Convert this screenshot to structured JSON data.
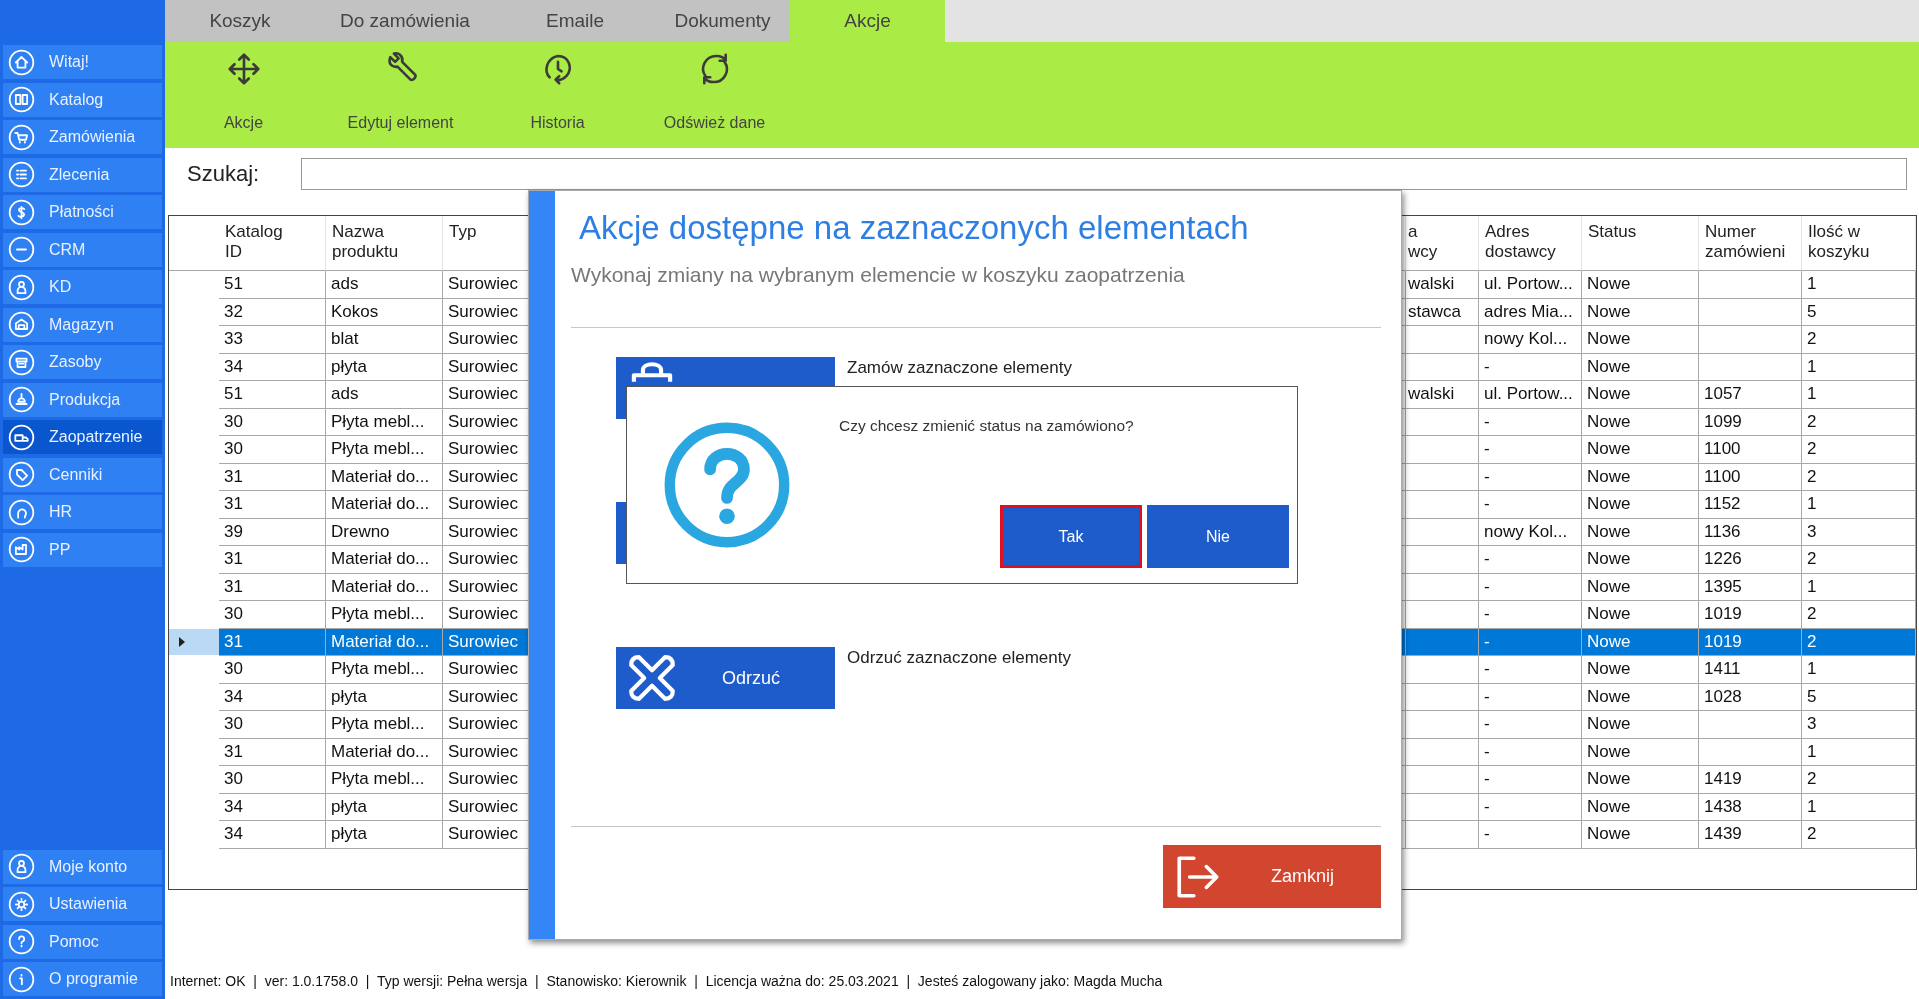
{
  "sidebar": {
    "items": [
      {
        "label": "Witaj!",
        "selected": false
      },
      {
        "label": "Katalog",
        "selected": false
      },
      {
        "label": "Zamówienia",
        "selected": false
      },
      {
        "label": "Zlecenia",
        "selected": false
      },
      {
        "label": "Płatności",
        "selected": false
      },
      {
        "label": "CRM",
        "selected": false
      },
      {
        "label": "KD",
        "selected": false
      },
      {
        "label": "Magazyn",
        "selected": false
      },
      {
        "label": "Zasoby",
        "selected": false
      },
      {
        "label": "Produkcja",
        "selected": false
      },
      {
        "label": "Zaopatrzenie",
        "selected": true
      },
      {
        "label": "Cenniki",
        "selected": false
      },
      {
        "label": "HR",
        "selected": false
      },
      {
        "label": "PP",
        "selected": false
      }
    ],
    "bottom_items": [
      {
        "label": "Moje konto"
      },
      {
        "label": "Ustawienia"
      },
      {
        "label": "Pomoc"
      },
      {
        "label": "O programie"
      }
    ]
  },
  "tabs": [
    {
      "label": "Koszyk",
      "selected": false
    },
    {
      "label": "Do zamówienia",
      "selected": false
    },
    {
      "label": "Emaile",
      "selected": false
    },
    {
      "label": "Dokumenty",
      "selected": false
    },
    {
      "label": "Akcje",
      "selected": true
    }
  ],
  "toolbar": [
    {
      "label": "Akcje"
    },
    {
      "label": "Edytuj element"
    },
    {
      "label": "Historia"
    },
    {
      "label": "Odśwież dane"
    }
  ],
  "search": {
    "label": "Szukaj:"
  },
  "table": {
    "columns": [
      "Katalog\nID",
      "Nazwa\nproduktu",
      "Typ",
      null,
      "a\nwcy",
      "Adres\ndostawcy",
      "Status",
      "Numer\nzamówieni",
      "Ilość w\nkoszyku"
    ],
    "rows": [
      {
        "selected": false,
        "cells": [
          "51",
          "ads",
          "Surowiec",
          null,
          "walski",
          "ul. Portow...",
          "Nowe",
          null,
          "1"
        ]
      },
      {
        "selected": false,
        "cells": [
          "32",
          "Kokos",
          "Surowiec",
          null,
          "stawca",
          "adres Mia...",
          "Nowe",
          null,
          "5"
        ]
      },
      {
        "selected": false,
        "cells": [
          "33",
          "blat",
          "Surowiec",
          null,
          null,
          "nowy Kol...",
          "Nowe",
          null,
          "2"
        ]
      },
      {
        "selected": false,
        "cells": [
          "34",
          "płyta",
          "Surowiec",
          null,
          null,
          "-",
          "Nowe",
          null,
          "1"
        ]
      },
      {
        "selected": false,
        "cells": [
          "51",
          "ads",
          "Surowiec",
          null,
          "walski",
          "ul. Portow...",
          "Nowe",
          "1057",
          "1"
        ]
      },
      {
        "selected": false,
        "cells": [
          "30",
          "Płyta mebl...",
          "Surowiec",
          null,
          null,
          "-",
          "Nowe",
          "1099",
          "2"
        ]
      },
      {
        "selected": false,
        "cells": [
          "30",
          "Płyta mebl...",
          "Surowiec",
          null,
          null,
          "-",
          "Nowe",
          "1100",
          "2"
        ]
      },
      {
        "selected": false,
        "cells": [
          "31",
          "Materiał do...",
          "Surowiec",
          null,
          null,
          "-",
          "Nowe",
          "1100",
          "2"
        ]
      },
      {
        "selected": false,
        "cells": [
          "31",
          "Materiał do...",
          "Surowiec",
          null,
          null,
          "-",
          "Nowe",
          "1152",
          "1"
        ]
      },
      {
        "selected": false,
        "cells": [
          "39",
          "Drewno",
          "Surowiec",
          null,
          null,
          "nowy Kol...",
          "Nowe",
          "1136",
          "3"
        ]
      },
      {
        "selected": false,
        "cells": [
          "31",
          "Materiał do...",
          "Surowiec",
          null,
          null,
          "-",
          "Nowe",
          "1226",
          "2"
        ]
      },
      {
        "selected": false,
        "cells": [
          "31",
          "Materiał do...",
          "Surowiec",
          null,
          null,
          "-",
          "Nowe",
          "1395",
          "1"
        ]
      },
      {
        "selected": false,
        "cells": [
          "30",
          "Płyta mebl...",
          "Surowiec",
          null,
          null,
          "-",
          "Nowe",
          "1019",
          "2"
        ]
      },
      {
        "selected": true,
        "cells": [
          "31",
          "Materiał do...",
          "Surowiec",
          null,
          null,
          "-",
          "Nowe",
          "1019",
          "2"
        ]
      },
      {
        "selected": false,
        "cells": [
          "30",
          "Płyta mebl...",
          "Surowiec",
          null,
          null,
          "-",
          "Nowe",
          "1411",
          "1"
        ]
      },
      {
        "selected": false,
        "cells": [
          "34",
          "płyta",
          "Surowiec",
          null,
          null,
          "-",
          "Nowe",
          "1028",
          "5"
        ]
      },
      {
        "selected": false,
        "cells": [
          "30",
          "Płyta mebl...",
          "Surowiec",
          null,
          null,
          "-",
          "Nowe",
          null,
          "3"
        ]
      },
      {
        "selected": false,
        "cells": [
          "31",
          "Materiał do...",
          "Surowiec",
          null,
          null,
          "-",
          "Nowe",
          null,
          "1"
        ]
      },
      {
        "selected": false,
        "cells": [
          "30",
          "Płyta mebl...",
          "Surowiec",
          null,
          null,
          "-",
          "Nowe",
          "1419",
          "2"
        ]
      },
      {
        "selected": false,
        "cells": [
          "34",
          "płyta",
          "Surowiec",
          null,
          null,
          "-",
          "Nowe",
          "1438",
          "1"
        ]
      },
      {
        "selected": false,
        "cells": [
          "34",
          "płyta",
          "Surowiec",
          null,
          null,
          "-",
          "Nowe",
          "1439",
          "2"
        ]
      }
    ]
  },
  "dialog": {
    "title": "Akcje dostępne na zaznaczonych elementach",
    "subtitle": "Wykonaj zmiany na wybranym elemencie w koszyku zaopatrzenia",
    "actions": [
      {
        "kind": "order",
        "description": "Zamów zaznaczone elementy"
      },
      {
        "kind": "other"
      },
      {
        "kind": "reject",
        "button": "Odrzuć",
        "description": "Odrzuć zaznaczone elementy"
      }
    ],
    "close_button": "Zamknij",
    "message_box": {
      "text": "Czy chcesz zmienić status na zamówiono?",
      "buttons": [
        {
          "label": "Tak",
          "focused": true
        },
        {
          "label": "Nie",
          "focused": false
        }
      ]
    }
  },
  "status_bar": "Internet: OK  |  ver: 1.0.1758.0  |  Typ wersji: Pełna wersja  |  Stanowisko: Kierownik  |  Licencja ważna do: 25.03.2021  |  Jesteś zalogowany jako: Magda Mucha"
}
